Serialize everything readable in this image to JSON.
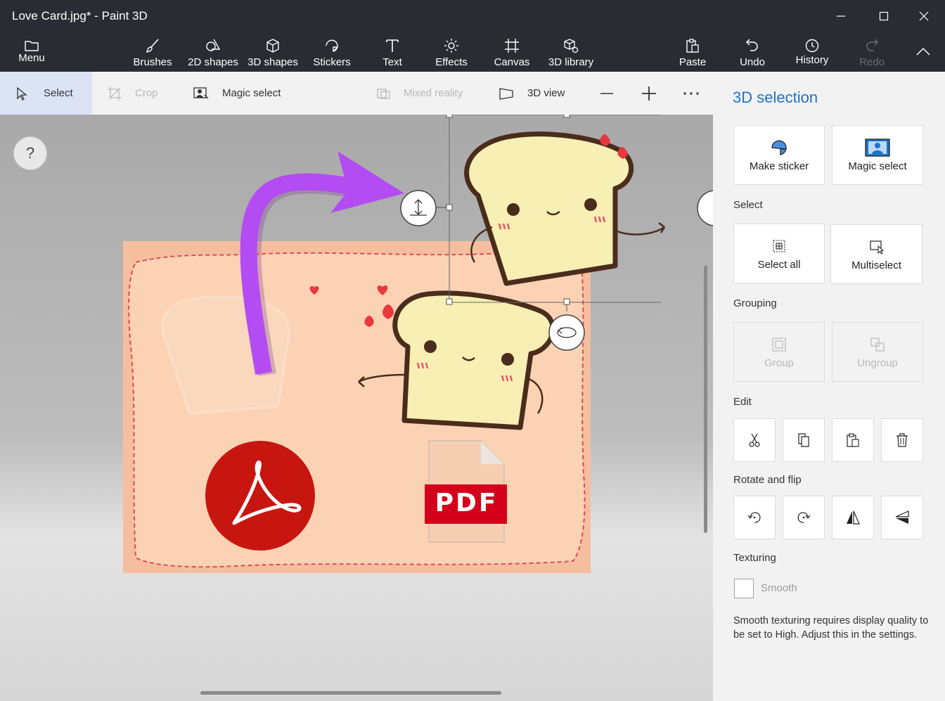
{
  "window": {
    "title": "Love Card.jpg* - Paint 3D"
  },
  "toolbar": {
    "menu": "Menu",
    "brushes": "Brushes",
    "shapes2d": "2D shapes",
    "shapes3d": "3D shapes",
    "stickers": "Stickers",
    "text": "Text",
    "effects": "Effects",
    "canvas": "Canvas",
    "library3d": "3D library",
    "paste": "Paste",
    "undo": "Undo",
    "history": "History",
    "redo": "Redo"
  },
  "subbar": {
    "select": "Select",
    "crop": "Crop",
    "magic_select": "Magic select",
    "mixed_reality": "Mixed reality",
    "view3d": "3D view",
    "zoom_out": "—",
    "zoom_in": "+",
    "more": "···"
  },
  "canvas": {
    "help": "?",
    "pdf_label": "PDF"
  },
  "panel": {
    "title": "3D selection",
    "make_sticker": "Make sticker",
    "magic_select": "Magic select",
    "select_heading": "Select",
    "select_all": "Select all",
    "multiselect": "Multiselect",
    "grouping_heading": "Grouping",
    "group": "Group",
    "ungroup": "Ungroup",
    "edit_heading": "Edit",
    "rotate_heading": "Rotate and flip",
    "texturing_heading": "Texturing",
    "smooth": "Smooth",
    "note": "Smooth texturing requires display quality to be set to High. Adjust this in the settings."
  },
  "colors": {
    "accent": "#1e73c8",
    "arrow": "#b34cf2",
    "card": "#f5bf9f",
    "pdf_red": "#d4001b"
  }
}
